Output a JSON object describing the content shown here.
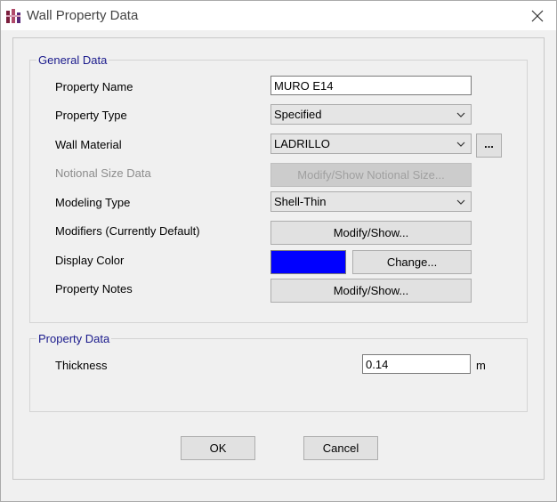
{
  "window": {
    "title": "Wall Property Data",
    "icon": "app-icon"
  },
  "general": {
    "group_title": "General Data",
    "property_name_label": "Property Name",
    "property_name_value": "MURO E14",
    "property_type_label": "Property Type",
    "property_type_value": "Specified",
    "wall_material_label": "Wall Material",
    "wall_material_value": "LADRILLO",
    "ellipsis_label": "...",
    "notional_label": "Notional Size Data",
    "notional_button": "Modify/Show Notional Size...",
    "modeling_type_label": "Modeling Type",
    "modeling_type_value": "Shell-Thin",
    "modifiers_label": "Modifiers (Currently Default)",
    "modifiers_button": "Modify/Show...",
    "display_color_label": "Display Color",
    "display_color_value": "#0000ff",
    "change_button": "Change...",
    "property_notes_label": "Property Notes",
    "property_notes_button": "Modify/Show..."
  },
  "property": {
    "group_title": "Property Data",
    "thickness_label": "Thickness",
    "thickness_value": "0.14",
    "thickness_unit": "m"
  },
  "buttons": {
    "ok": "OK",
    "cancel": "Cancel"
  }
}
